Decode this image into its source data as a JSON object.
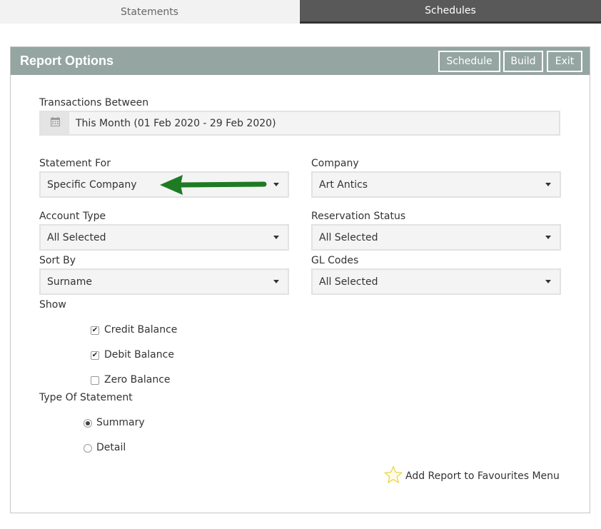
{
  "tabs": {
    "statements": "Statements",
    "schedules": "Schedules"
  },
  "panel": {
    "title": "Report Options",
    "buttons": {
      "schedule": "Schedule",
      "build": "Build",
      "exit": "Exit"
    }
  },
  "fields": {
    "transactions_between": {
      "label": "Transactions Between",
      "value": "This Month (01 Feb 2020 - 29 Feb 2020)"
    },
    "statement_for": {
      "label": "Statement For",
      "value": "Specific Company"
    },
    "company": {
      "label": "Company",
      "value": "Art Antics"
    },
    "account_type": {
      "label": "Account Type",
      "value": "All Selected"
    },
    "reservation_status": {
      "label": "Reservation Status",
      "value": "All Selected"
    },
    "sort_by": {
      "label": "Sort By",
      "value": "Surname"
    },
    "gl_codes": {
      "label": "GL Codes",
      "value": "All Selected"
    }
  },
  "show": {
    "label": "Show",
    "options": [
      {
        "label": "Credit Balance",
        "checked": true
      },
      {
        "label": "Debit Balance",
        "checked": true
      },
      {
        "label": "Zero Balance",
        "checked": false
      }
    ]
  },
  "statement_type": {
    "label": "Type Of Statement",
    "options": [
      {
        "label": "Summary",
        "selected": true
      },
      {
        "label": "Detail",
        "selected": false
      }
    ]
  },
  "favourites": {
    "label": "Add Report to Favourites Menu"
  },
  "colors": {
    "header_bg": "#95a5a2",
    "active_tab_bg": "#595959",
    "arrow": "#1f7a24",
    "star": "#e8d64a"
  },
  "icons": {
    "calendar": "calendar-icon",
    "dropdown": "chevron-down-icon",
    "favourite": "star-icon",
    "annotation": "arrow-icon"
  }
}
